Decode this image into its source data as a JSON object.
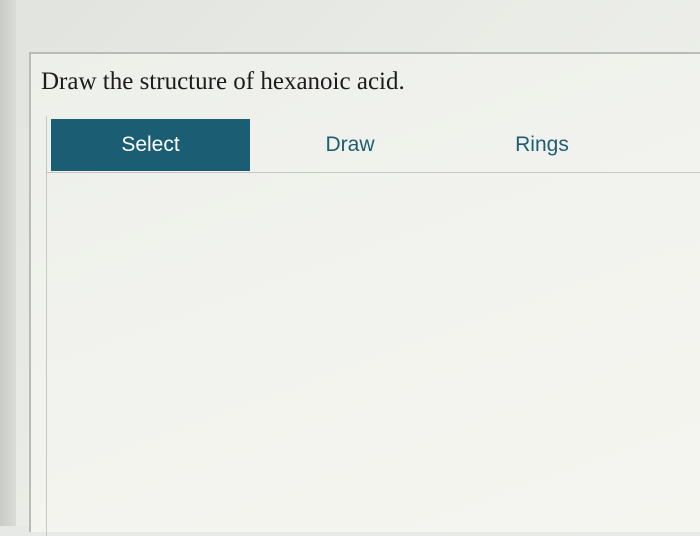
{
  "question": {
    "text": "Draw the structure of hexanoic acid."
  },
  "toolbar": {
    "tabs": [
      {
        "label": "Select",
        "active": true
      },
      {
        "label": "Draw",
        "active": false
      },
      {
        "label": "Rings",
        "active": false
      }
    ]
  },
  "colors": {
    "accent": "#1b5e74",
    "tab_text": "#1e5e72",
    "active_tab_text": "#ffffff"
  }
}
